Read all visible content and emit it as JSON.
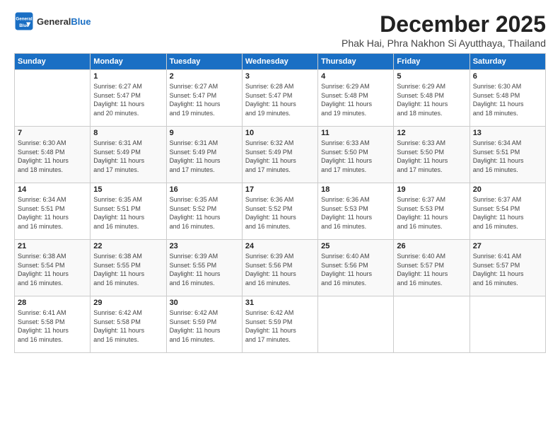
{
  "header": {
    "logo_general": "General",
    "logo_blue": "Blue",
    "month_title": "December 2025",
    "location": "Phak Hai, Phra Nakhon Si Ayutthaya, Thailand"
  },
  "days_of_week": [
    "Sunday",
    "Monday",
    "Tuesday",
    "Wednesday",
    "Thursday",
    "Friday",
    "Saturday"
  ],
  "weeks": [
    [
      {
        "day": "",
        "details": ""
      },
      {
        "day": "1",
        "details": "Sunrise: 6:27 AM\nSunset: 5:47 PM\nDaylight: 11 hours\nand 20 minutes."
      },
      {
        "day": "2",
        "details": "Sunrise: 6:27 AM\nSunset: 5:47 PM\nDaylight: 11 hours\nand 19 minutes."
      },
      {
        "day": "3",
        "details": "Sunrise: 6:28 AM\nSunset: 5:47 PM\nDaylight: 11 hours\nand 19 minutes."
      },
      {
        "day": "4",
        "details": "Sunrise: 6:29 AM\nSunset: 5:48 PM\nDaylight: 11 hours\nand 19 minutes."
      },
      {
        "day": "5",
        "details": "Sunrise: 6:29 AM\nSunset: 5:48 PM\nDaylight: 11 hours\nand 18 minutes."
      },
      {
        "day": "6",
        "details": "Sunrise: 6:30 AM\nSunset: 5:48 PM\nDaylight: 11 hours\nand 18 minutes."
      }
    ],
    [
      {
        "day": "7",
        "details": "Sunrise: 6:30 AM\nSunset: 5:48 PM\nDaylight: 11 hours\nand 18 minutes."
      },
      {
        "day": "8",
        "details": "Sunrise: 6:31 AM\nSunset: 5:49 PM\nDaylight: 11 hours\nand 17 minutes."
      },
      {
        "day": "9",
        "details": "Sunrise: 6:31 AM\nSunset: 5:49 PM\nDaylight: 11 hours\nand 17 minutes."
      },
      {
        "day": "10",
        "details": "Sunrise: 6:32 AM\nSunset: 5:49 PM\nDaylight: 11 hours\nand 17 minutes."
      },
      {
        "day": "11",
        "details": "Sunrise: 6:33 AM\nSunset: 5:50 PM\nDaylight: 11 hours\nand 17 minutes."
      },
      {
        "day": "12",
        "details": "Sunrise: 6:33 AM\nSunset: 5:50 PM\nDaylight: 11 hours\nand 17 minutes."
      },
      {
        "day": "13",
        "details": "Sunrise: 6:34 AM\nSunset: 5:51 PM\nDaylight: 11 hours\nand 16 minutes."
      }
    ],
    [
      {
        "day": "14",
        "details": "Sunrise: 6:34 AM\nSunset: 5:51 PM\nDaylight: 11 hours\nand 16 minutes."
      },
      {
        "day": "15",
        "details": "Sunrise: 6:35 AM\nSunset: 5:51 PM\nDaylight: 11 hours\nand 16 minutes."
      },
      {
        "day": "16",
        "details": "Sunrise: 6:35 AM\nSunset: 5:52 PM\nDaylight: 11 hours\nand 16 minutes."
      },
      {
        "day": "17",
        "details": "Sunrise: 6:36 AM\nSunset: 5:52 PM\nDaylight: 11 hours\nand 16 minutes."
      },
      {
        "day": "18",
        "details": "Sunrise: 6:36 AM\nSunset: 5:53 PM\nDaylight: 11 hours\nand 16 minutes."
      },
      {
        "day": "19",
        "details": "Sunrise: 6:37 AM\nSunset: 5:53 PM\nDaylight: 11 hours\nand 16 minutes."
      },
      {
        "day": "20",
        "details": "Sunrise: 6:37 AM\nSunset: 5:54 PM\nDaylight: 11 hours\nand 16 minutes."
      }
    ],
    [
      {
        "day": "21",
        "details": "Sunrise: 6:38 AM\nSunset: 5:54 PM\nDaylight: 11 hours\nand 16 minutes."
      },
      {
        "day": "22",
        "details": "Sunrise: 6:38 AM\nSunset: 5:55 PM\nDaylight: 11 hours\nand 16 minutes."
      },
      {
        "day": "23",
        "details": "Sunrise: 6:39 AM\nSunset: 5:55 PM\nDaylight: 11 hours\nand 16 minutes."
      },
      {
        "day": "24",
        "details": "Sunrise: 6:39 AM\nSunset: 5:56 PM\nDaylight: 11 hours\nand 16 minutes."
      },
      {
        "day": "25",
        "details": "Sunrise: 6:40 AM\nSunset: 5:56 PM\nDaylight: 11 hours\nand 16 minutes."
      },
      {
        "day": "26",
        "details": "Sunrise: 6:40 AM\nSunset: 5:57 PM\nDaylight: 11 hours\nand 16 minutes."
      },
      {
        "day": "27",
        "details": "Sunrise: 6:41 AM\nSunset: 5:57 PM\nDaylight: 11 hours\nand 16 minutes."
      }
    ],
    [
      {
        "day": "28",
        "details": "Sunrise: 6:41 AM\nSunset: 5:58 PM\nDaylight: 11 hours\nand 16 minutes."
      },
      {
        "day": "29",
        "details": "Sunrise: 6:42 AM\nSunset: 5:58 PM\nDaylight: 11 hours\nand 16 minutes."
      },
      {
        "day": "30",
        "details": "Sunrise: 6:42 AM\nSunset: 5:59 PM\nDaylight: 11 hours\nand 16 minutes."
      },
      {
        "day": "31",
        "details": "Sunrise: 6:42 AM\nSunset: 5:59 PM\nDaylight: 11 hours\nand 17 minutes."
      },
      {
        "day": "",
        "details": ""
      },
      {
        "day": "",
        "details": ""
      },
      {
        "day": "",
        "details": ""
      }
    ]
  ]
}
